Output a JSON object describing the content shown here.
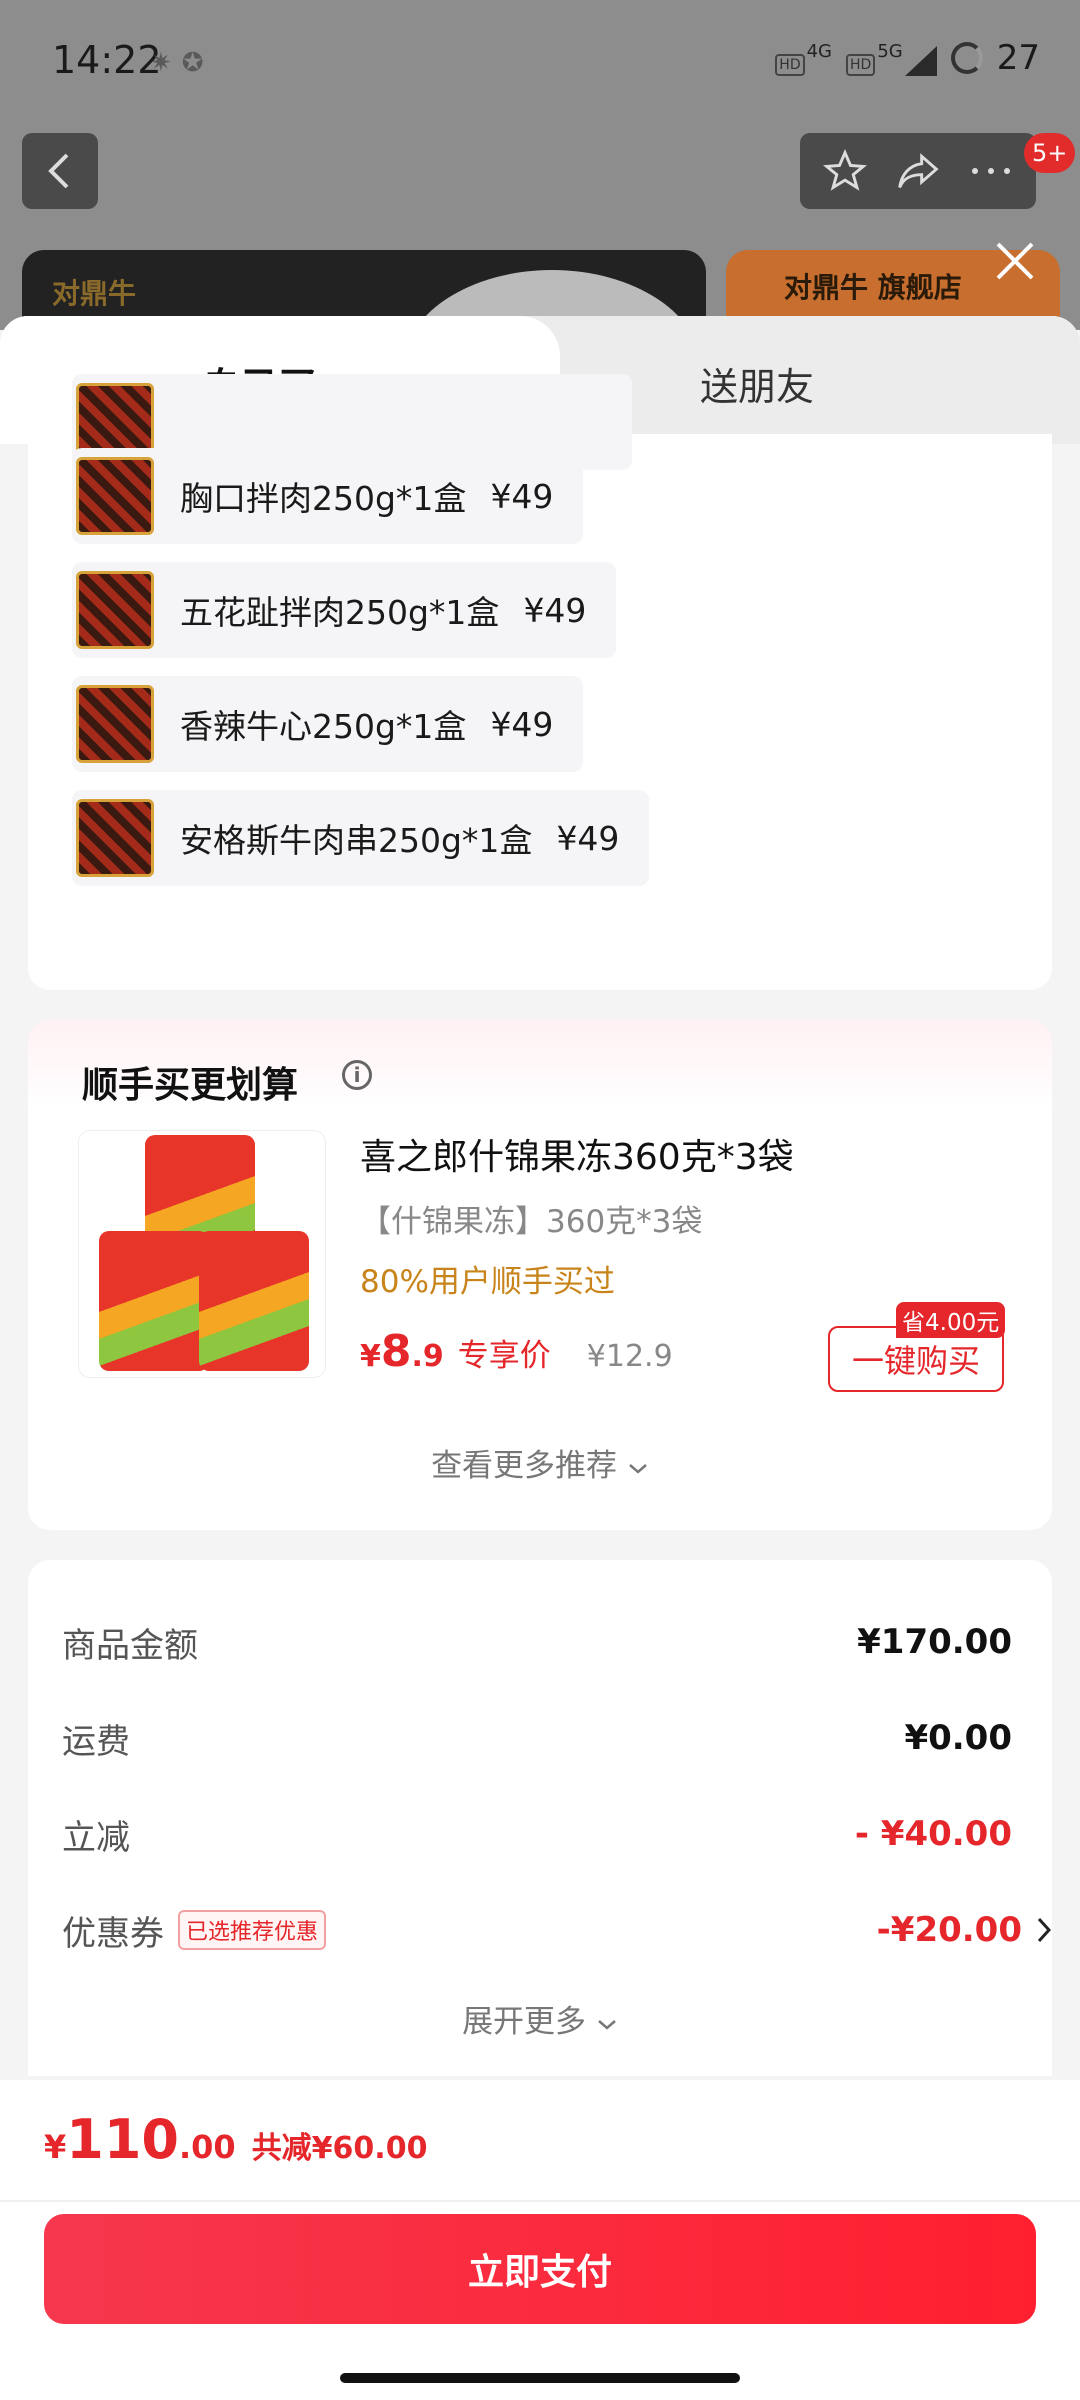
{
  "status_bar": {
    "time": "14:22",
    "net1": "4G",
    "net2": "5G",
    "hd": "HD",
    "battery": "27"
  },
  "background": {
    "badge_count": "5+",
    "banner_left_brand": "对鼎牛",
    "banner_right_brand": "对鼎牛 旗舰店"
  },
  "tabs": {
    "self": "自己买",
    "gift": "送朋友"
  },
  "gift_items": [
    {
      "name": "胸口拌肉250g*1盒",
      "price": "¥49"
    },
    {
      "name": "五花趾拌肉250g*1盒",
      "price": "¥49"
    },
    {
      "name": "香辣牛心250g*1盒",
      "price": "¥49"
    },
    {
      "name": "安格斯牛肉串250g*1盒",
      "price": "¥49"
    }
  ],
  "addon": {
    "title": "顺手买更划算",
    "info": "i",
    "product_name": "喜之郎什锦果冻360克*3袋",
    "spec": "【什锦果冻】360克*3袋",
    "social_proof": "80%用户顺手买过",
    "price_symbol": "¥",
    "price_int": "8",
    "price_dec": ".9",
    "price_tag": "专享价",
    "original_price": "¥12.9",
    "save_tag": "省4.00元",
    "buy_button": "一键购买",
    "more": "查看更多推荐"
  },
  "summary": {
    "goods_label": "商品金额",
    "goods_value": "¥170.00",
    "shipping_label": "运费",
    "shipping_value": "¥0.00",
    "discount_label": "立减",
    "discount_value": "- ¥40.00",
    "coupon_label": "优惠券",
    "coupon_tag": "已选推荐优惠",
    "coupon_value": "-¥20.00",
    "expand": "展开更多"
  },
  "footer": {
    "total_symbol": "¥",
    "total_int": "110",
    "total_dec": ".00",
    "total_saved": "共减¥60.00",
    "pay_button": "立即支付"
  },
  "colors": {
    "accent_red": "#e5262a",
    "social_orange": "#c8841a"
  }
}
